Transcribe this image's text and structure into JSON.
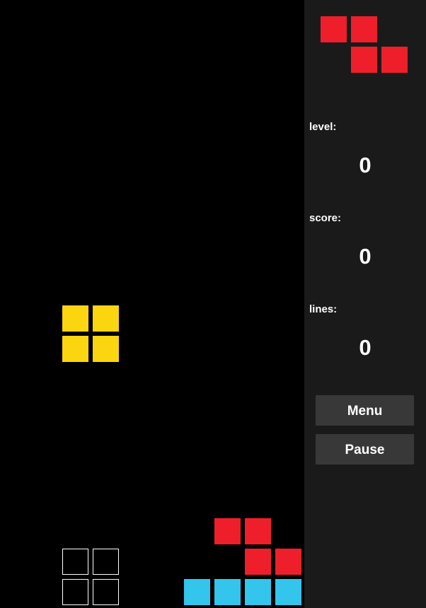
{
  "sidebar": {
    "level_label": "level:",
    "level_value": "0",
    "score_label": "score:",
    "score_value": "0",
    "lines_label": "lines:",
    "lines_value": "0",
    "menu_button": "Menu",
    "pause_button": "Pause"
  },
  "colors": {
    "z_piece": "#ee1f2b",
    "o_piece": "#fad510",
    "i_piece": "#33c5ec",
    "ghost_border": "#ffffff",
    "board_bg": "#000000",
    "sidebar_bg": "#1a1a1a",
    "button_bg": "#383838"
  },
  "next_piece": {
    "shape": "Z",
    "color_key": "z_piece"
  },
  "active_piece": {
    "shape": "O",
    "color_key": "o_piece"
  },
  "board": {
    "ghost_piece": "O",
    "stacked_pieces": [
      {
        "shape": "Z",
        "color_key": "z_piece"
      },
      {
        "shape": "I",
        "color_key": "i_piece"
      }
    ]
  }
}
